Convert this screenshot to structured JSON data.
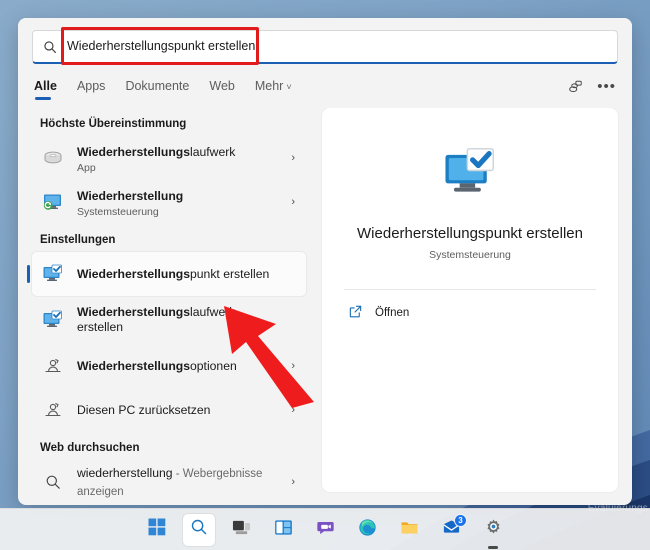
{
  "search": {
    "query": "Wiederherstellungspunkt erstellen",
    "icon": "search-icon",
    "annotation": "red-highlight-box"
  },
  "tabs": [
    {
      "label": "Alle",
      "active": true
    },
    {
      "label": "Apps",
      "active": false
    },
    {
      "label": "Dokumente",
      "active": false
    },
    {
      "label": "Web",
      "active": false
    },
    {
      "label": "Mehr",
      "active": false,
      "chevron": "˅"
    }
  ],
  "tab_actions": {
    "feedback_icon": "people-feedback-icon",
    "more_label": "•••"
  },
  "sections": [
    {
      "heading": "Höchste Übereinstimmung",
      "items": [
        {
          "title_bold": "Wiederherstellungs",
          "title_rest": "laufwerk",
          "subtitle": "App",
          "icon": "hard-drive-icon",
          "chevron": "›",
          "selected": false
        },
        {
          "title_bold": "Wiederherstellung",
          "title_rest": "",
          "subtitle": "Systemsteuerung",
          "icon": "monitor-restore-icon",
          "chevron": "›",
          "selected": false
        }
      ]
    },
    {
      "heading": "Einstellungen",
      "items": [
        {
          "title_bold": "Wiederherstellungs",
          "title_rest": "punkt erstellen",
          "subtitle": "",
          "icon": "monitor-check-icon",
          "chevron": "",
          "selected": true
        },
        {
          "title_bold": "Wiederherstellungs",
          "title_rest": "laufwerk erstellen",
          "subtitle": "",
          "icon": "monitor-check-icon",
          "chevron": "",
          "selected": false
        },
        {
          "title_bold": "Wiederherstellungs",
          "title_rest": "optionen",
          "subtitle": "",
          "icon": "recovery-options-icon",
          "chevron": "›",
          "selected": false
        },
        {
          "title_bold": "",
          "title_rest": "Diesen PC zurücksetzen",
          "subtitle": "",
          "icon": "recovery-options-icon",
          "chevron": "›",
          "selected": false
        }
      ]
    },
    {
      "heading": "Web durchsuchen",
      "items": [
        {
          "title_bold": "",
          "title_rest": "wiederherstellung",
          "web_suffix": " - Webergebnisse anzeigen",
          "subtitle": "",
          "icon": "search-icon",
          "chevron": "›",
          "selected": false
        }
      ]
    }
  ],
  "preview": {
    "hero_icon": "monitor-check-icon",
    "title": "Wiederherstellungspunkt erstellen",
    "subtitle": "Systemsteuerung",
    "action_label": "Öffnen",
    "action_icon": "open-external-icon"
  },
  "wallpaper": {
    "watermark": "Evaluierungs"
  },
  "taskbar": [
    {
      "name": "start",
      "icon": "windows-logo-icon",
      "active": false,
      "running": false
    },
    {
      "name": "search",
      "icon": "search-icon",
      "active": true,
      "running": false
    },
    {
      "name": "task-view",
      "icon": "task-view-icon",
      "active": false,
      "running": false
    },
    {
      "name": "widgets",
      "icon": "widgets-icon",
      "active": false,
      "running": false
    },
    {
      "name": "chat",
      "icon": "chat-teams-icon",
      "active": false,
      "running": false
    },
    {
      "name": "edge",
      "icon": "edge-browser-icon",
      "active": false,
      "running": false
    },
    {
      "name": "file-explorer",
      "icon": "folder-icon",
      "active": false,
      "running": false
    },
    {
      "name": "mail",
      "icon": "mail-icon",
      "active": false,
      "running": false,
      "badge": "3"
    },
    {
      "name": "settings",
      "icon": "gear-icon",
      "active": false,
      "running": true
    }
  ],
  "colors": {
    "accent": "#1a5fb4",
    "annotation_red": "#e01b1b",
    "panel_bg": "#f3f3f3",
    "card_bg": "#ffffff"
  }
}
